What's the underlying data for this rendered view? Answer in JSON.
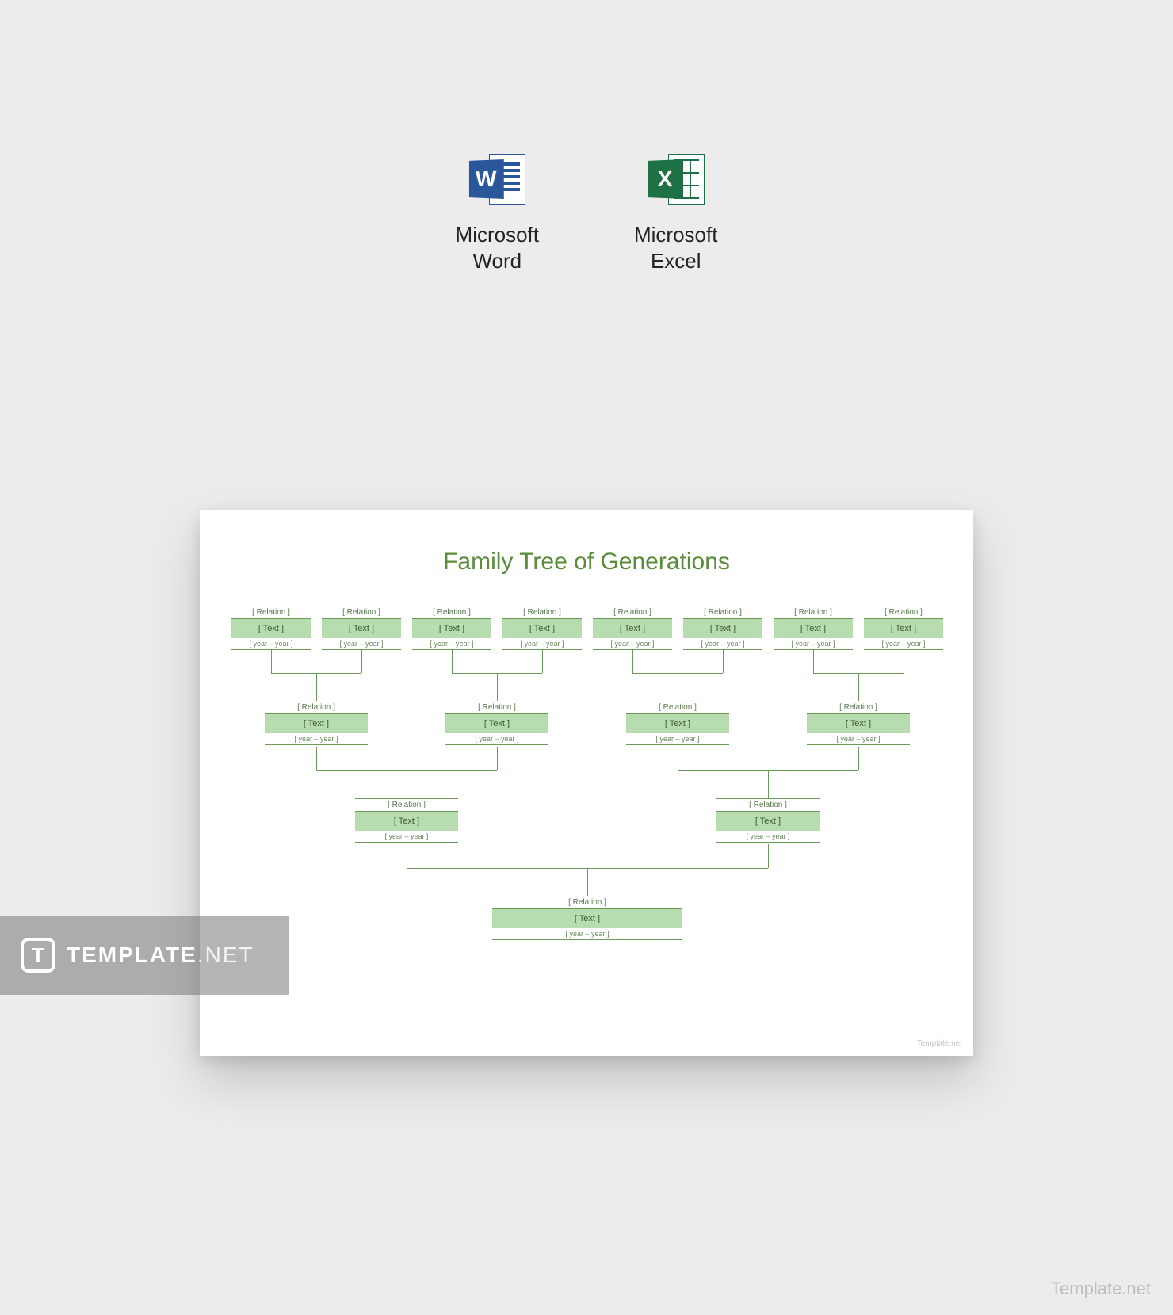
{
  "apps": [
    {
      "name": "Microsoft\nWord"
    },
    {
      "name": "Microsoft\nExcel"
    }
  ],
  "preview": {
    "title": "Family Tree of Generations",
    "placeholders": {
      "relation": "[ Relation ]",
      "text": "[ Text ]",
      "year": "[ year – year ]"
    },
    "corner": "Template.net"
  },
  "watermark": {
    "icon_letter": "T",
    "brand_bold": "TEMPLATE",
    "brand_light": ".NET"
  },
  "corner_watermark": "Template.net",
  "chart_data": {
    "type": "tree",
    "title": "Family Tree of Generations",
    "levels": [
      {
        "generation": 4,
        "count": 8,
        "fields": [
          "Relation",
          "Text",
          "year – year"
        ]
      },
      {
        "generation": 3,
        "count": 4,
        "fields": [
          "Relation",
          "Text",
          "year – year"
        ]
      },
      {
        "generation": 2,
        "count": 2,
        "fields": [
          "Relation",
          "Text",
          "year – year"
        ]
      },
      {
        "generation": 1,
        "count": 1,
        "fields": [
          "Relation",
          "Text",
          "year – year"
        ]
      }
    ],
    "node_template": {
      "relation": "[ Relation ]",
      "text": "[ Text ]",
      "year": "[ year – year ]"
    }
  }
}
